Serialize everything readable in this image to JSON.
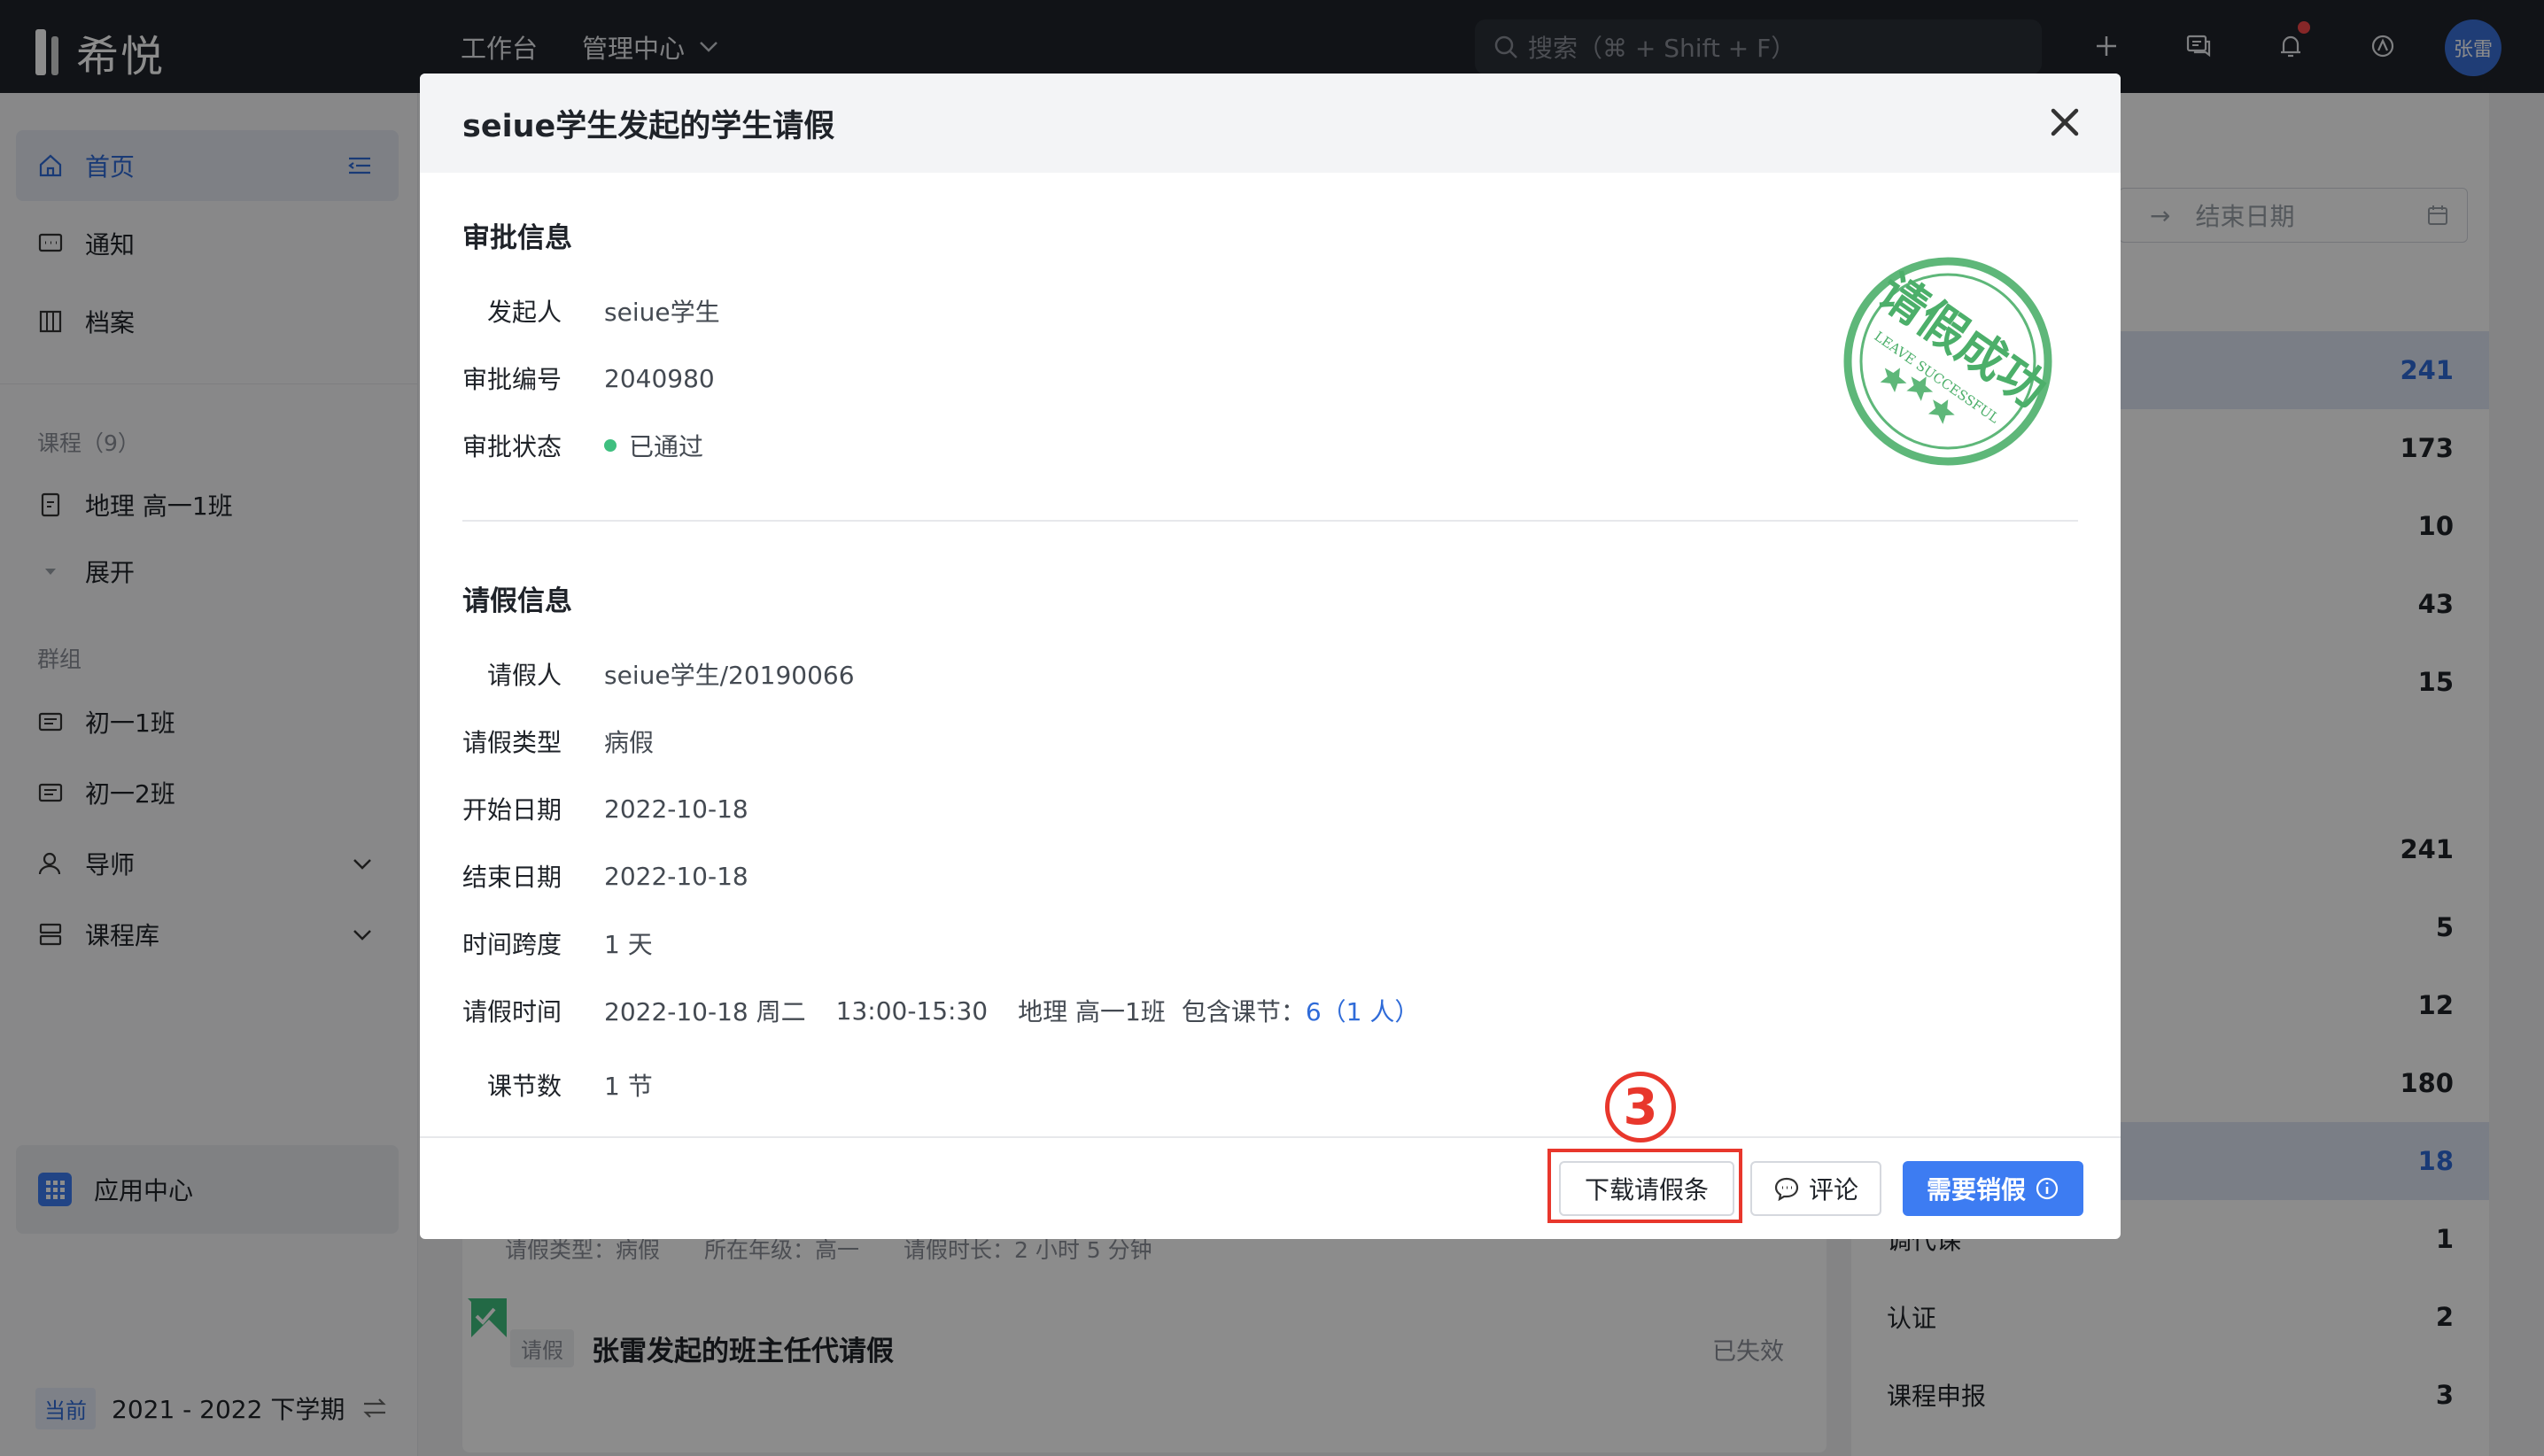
{
  "topbar": {
    "logo": "希悦",
    "nav": [
      "工作台",
      "管理中心"
    ],
    "search_placeholder": "搜索（⌘ + Shift + F）",
    "user": "张雷"
  },
  "sidebar": {
    "items": [
      {
        "label": "首页"
      },
      {
        "label": "通知"
      },
      {
        "label": "档案"
      }
    ],
    "course_group": "课程（9）",
    "course_items": [
      {
        "label": "地理 高一1班"
      },
      {
        "label": "展开"
      }
    ],
    "group_label": "群组",
    "group_items": [
      {
        "label": "初一1班"
      },
      {
        "label": "初一2班"
      },
      {
        "label": "导师"
      },
      {
        "label": "课程库"
      }
    ],
    "app_center": "应用中心",
    "term_badge": "当前",
    "term": "2021 - 2022 下学期"
  },
  "background": {
    "end_date_placeholder": "结束日期",
    "card_meta": "请假类型：病假　　所在年级：高一　　请假时长：2 小时 5 分钟",
    "card_tag": "请假",
    "card_title": "张雷发起的班主任代请假",
    "card_status": "已失效",
    "stats": [
      {
        "label": "",
        "value": "241"
      },
      {
        "label": "",
        "value": "173"
      },
      {
        "label": "",
        "value": "10"
      },
      {
        "label": "",
        "value": "43"
      },
      {
        "label": "",
        "value": "15"
      },
      {
        "label": "",
        "value": "241"
      },
      {
        "label": "",
        "value": "5"
      },
      {
        "label": "",
        "value": "12"
      },
      {
        "label": "",
        "value": "180"
      },
      {
        "label": "",
        "value": "18"
      },
      {
        "label": "调代课",
        "value": "1"
      },
      {
        "label": "认证",
        "value": "2"
      },
      {
        "label": "课程申报",
        "value": "3"
      }
    ]
  },
  "modal": {
    "title": "seiue学生发起的学生请假",
    "approval_title": "审批信息",
    "approval": {
      "initiator_label": "发起人",
      "initiator": "seiue学生",
      "number_label": "审批编号",
      "number": "2040980",
      "status_label": "审批状态",
      "status": "已通过"
    },
    "leave_title": "请假信息",
    "leave": {
      "person_label": "请假人",
      "person": "seiue学生/20190066",
      "type_label": "请假类型",
      "type": "病假",
      "start_label": "开始日期",
      "start": "2022-10-18",
      "end_label": "结束日期",
      "end": "2022-10-18",
      "span_label": "时间跨度",
      "span": "1 天",
      "time_label": "请假时间",
      "time_date": "2022-10-18 周二",
      "time_range": "13:00-15:30",
      "time_course": "地理 高一1班",
      "time_lessons_label": "包含课节：",
      "time_lessons": "6（1 人）",
      "count_label": "课节数",
      "count": "1 节"
    },
    "stamp_text": "请假成功",
    "stamp_sub": "LEAVE SUCCESSFUL",
    "buttons": {
      "download": "下载请假条",
      "comment": "评论",
      "cancel_leave": "需要销假"
    },
    "step_marker": "3"
  },
  "colors": {
    "accent": "#3d7cf2",
    "success": "#3fbf7f",
    "highlight": "#e8372c",
    "stamp": "#4caf6a"
  }
}
